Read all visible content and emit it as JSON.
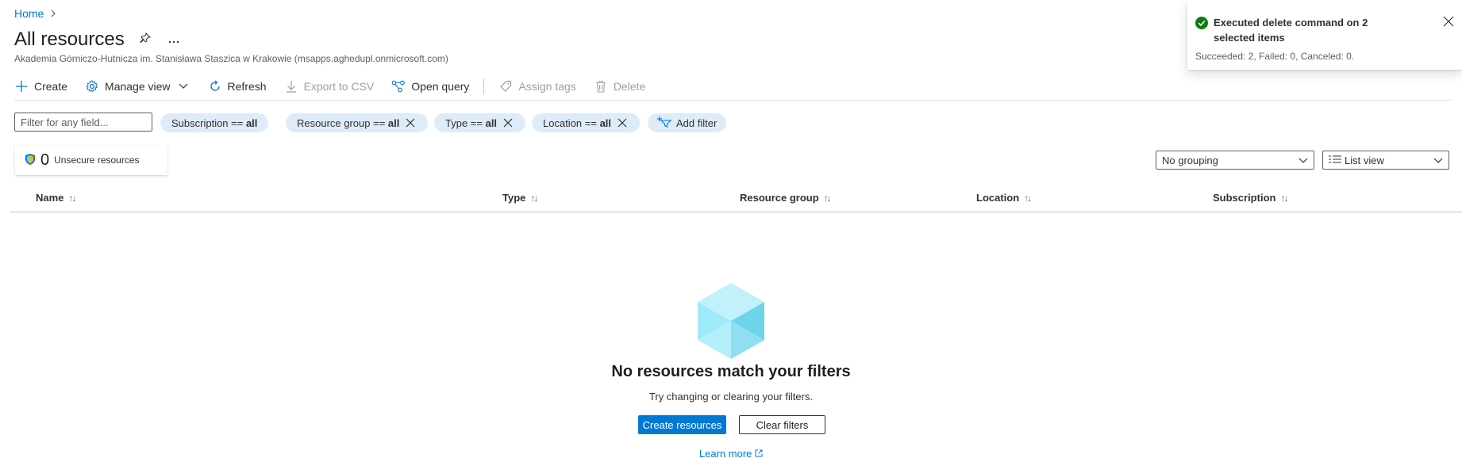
{
  "breadcrumb": {
    "home": "Home",
    "separator": ">"
  },
  "page": {
    "title": "All resources",
    "subtitle": "Akademia Górniczo-Hutnicza im. Stanisława Staszica w Krakowie (msapps.aghedupl.onmicrosoft.com)",
    "pin_icon": "pin-icon",
    "more_icon": "ellipsis-icon"
  },
  "toolbar": {
    "create": "Create",
    "manage_view": "Manage view",
    "refresh": "Refresh",
    "export_csv": "Export to CSV",
    "open_query": "Open query",
    "assign_tags": "Assign tags",
    "delete": "Delete"
  },
  "filters": {
    "placeholder": "Filter for any field...",
    "pills": [
      {
        "label": "Subscription == ",
        "value": "all"
      },
      {
        "label": "Resource group == ",
        "value": "all"
      },
      {
        "label": "Type == ",
        "value": "all"
      },
      {
        "label": "Location == ",
        "value": "all"
      }
    ],
    "add_filter": "Add filter"
  },
  "security_card": {
    "count": "0",
    "label": "Unsecure resources"
  },
  "view": {
    "grouping": "No grouping",
    "layout": "List view"
  },
  "columns": [
    "Name",
    "Type",
    "Resource group",
    "Location",
    "Subscription"
  ],
  "empty_state": {
    "title": "No resources match your filters",
    "subtitle": "Try changing or clearing your filters.",
    "create_button": "Create resources",
    "clear_button": "Clear filters",
    "learn_more": "Learn more"
  },
  "toast": {
    "title": "Executed delete command on 2 selected items",
    "message": "Succeeded: 2, Failed: 0, Canceled: 0."
  },
  "colors": {
    "accent": "#0078d4",
    "pill_bg": "#deecf9",
    "success": "#107c10"
  }
}
